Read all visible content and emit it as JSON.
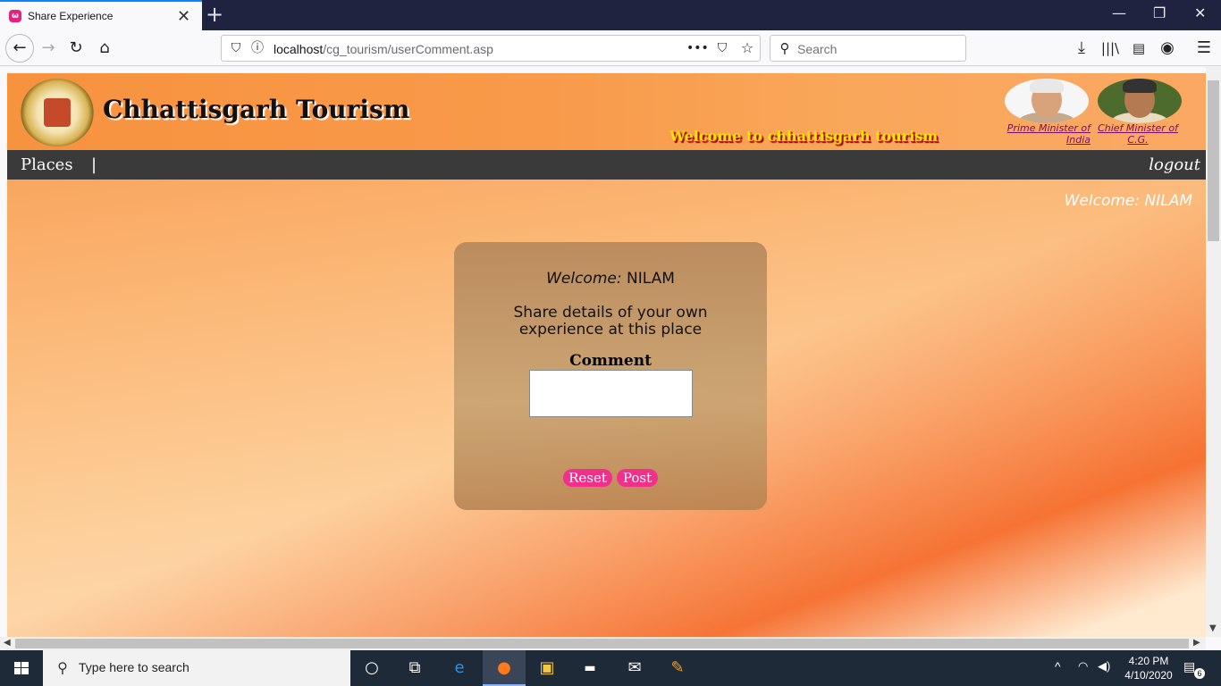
{
  "browser": {
    "tab_title": "Share Experience",
    "url_host": "localhost",
    "url_path": "/cg_tourism/userComment.asp",
    "search_placeholder": "Search"
  },
  "site": {
    "title": "Chhattisgarh Tourism",
    "marquee": "Welcome to chhattisgarh tourism",
    "pm_link_line1": "Prime Minister of",
    "pm_link_line2": "India",
    "cm_link_line1": "Chief Minister of",
    "cm_link_line2": "C.G."
  },
  "menu": {
    "places": "Places",
    "separator": "|",
    "logout": "logout"
  },
  "welcome_top": "Welcome: NILAM",
  "card": {
    "welcome_label": "Welcome:",
    "username": "NILAM",
    "share_text": "Share details of your own experience at this place",
    "comment_label": "Comment",
    "comment_value": "",
    "reset_label": "Reset",
    "post_label": "Post"
  },
  "taskbar": {
    "search_placeholder": "Type here to search",
    "time": "4:20 PM",
    "date": "4/10/2020",
    "notification_count": "6"
  },
  "colors": {
    "accent_button": "#f0308a",
    "menu_bar": "#3a3a3a",
    "header_orange": "#f7923f",
    "marquee_text": "#ffe300"
  }
}
